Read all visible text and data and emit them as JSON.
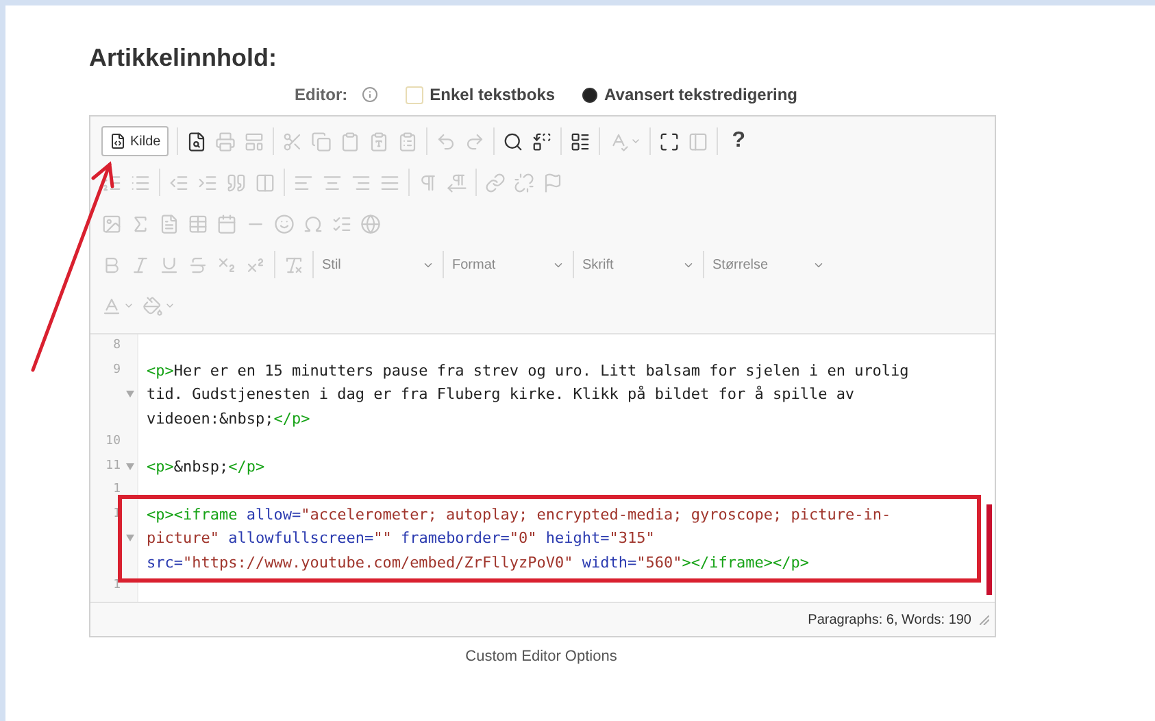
{
  "heading": "Artikkelinnhold:",
  "editor_options": {
    "label": "Editor:",
    "choices": [
      {
        "label": "Enkel tekstboks",
        "selected": false,
        "kind": "checkbox"
      },
      {
        "label": "Avansert tekstredigering",
        "selected": true,
        "kind": "radio"
      }
    ]
  },
  "toolbar": {
    "rows": [
      [
        [
          {
            "kind": "source",
            "label": "Kilde",
            "disabled": false
          }
        ],
        [
          {
            "kind": "icon",
            "disabled": false
          },
          {
            "kind": "icon",
            "disabled": true
          },
          {
            "kind": "icon",
            "disabled": true
          }
        ],
        [
          {
            "kind": "icon",
            "disabled": true
          },
          {
            "kind": "icon",
            "disabled": true
          },
          {
            "kind": "icon",
            "disabled": true
          },
          {
            "kind": "icon",
            "disabled": true
          },
          {
            "kind": "icon",
            "disabled": true
          }
        ],
        [
          {
            "kind": "icon",
            "disabled": true
          },
          {
            "kind": "icon",
            "disabled": true
          }
        ],
        [
          {
            "kind": "icon",
            "disabled": false
          },
          {
            "kind": "icon",
            "disabled": false
          }
        ],
        [
          {
            "kind": "icon",
            "disabled": false
          }
        ],
        [
          {
            "kind": "dropdown-icon",
            "disabled": true
          }
        ],
        [
          {
            "kind": "icon",
            "disabled": false
          },
          {
            "kind": "icon",
            "disabled": true
          }
        ],
        [
          {
            "kind": "text",
            "label": "?",
            "disabled": false
          }
        ]
      ],
      [
        [
          {
            "kind": "icon",
            "disabled": true
          },
          {
            "kind": "icon",
            "disabled": true
          }
        ],
        [
          {
            "kind": "icon",
            "disabled": true
          },
          {
            "kind": "icon",
            "disabled": true
          },
          {
            "kind": "icon",
            "disabled": true
          },
          {
            "kind": "icon",
            "disabled": true
          }
        ],
        [
          {
            "kind": "icon",
            "disabled": true
          },
          {
            "kind": "icon",
            "disabled": true
          },
          {
            "kind": "icon",
            "disabled": true
          },
          {
            "kind": "icon",
            "disabled": true
          }
        ],
        [
          {
            "kind": "icon",
            "disabled": true
          },
          {
            "kind": "icon",
            "disabled": true
          }
        ],
        [
          {
            "kind": "icon",
            "disabled": true
          },
          {
            "kind": "icon",
            "disabled": true
          },
          {
            "kind": "icon",
            "disabled": true
          }
        ]
      ],
      [
        [
          {
            "kind": "icon",
            "disabled": true
          },
          {
            "kind": "icon",
            "disabled": true
          },
          {
            "kind": "icon",
            "disabled": true
          },
          {
            "kind": "icon",
            "disabled": true
          },
          {
            "kind": "icon",
            "disabled": true
          },
          {
            "kind": "icon",
            "disabled": true
          },
          {
            "kind": "icon",
            "disabled": true
          },
          {
            "kind": "icon",
            "disabled": true
          },
          {
            "kind": "icon",
            "disabled": true
          },
          {
            "kind": "icon",
            "disabled": true
          }
        ]
      ],
      [
        [
          {
            "kind": "icon",
            "disabled": true
          },
          {
            "kind": "icon",
            "disabled": true
          },
          {
            "kind": "icon",
            "disabled": true
          },
          {
            "kind": "icon",
            "disabled": true
          },
          {
            "kind": "icon",
            "disabled": true
          },
          {
            "kind": "icon",
            "disabled": true
          }
        ],
        [
          {
            "kind": "icon",
            "disabled": true
          }
        ],
        [
          {
            "kind": "combo",
            "label": "Stil",
            "disabled": true
          }
        ],
        [
          {
            "kind": "combo",
            "label": "Format",
            "disabled": true
          }
        ],
        [
          {
            "kind": "combo",
            "label": "Skrift",
            "disabled": true
          }
        ],
        [
          {
            "kind": "combo",
            "label": "Størrelse",
            "disabled": true
          }
        ]
      ],
      [
        [
          {
            "kind": "dropdown-icon",
            "disabled": true
          },
          {
            "kind": "dropdown-icon",
            "disabled": true
          }
        ]
      ]
    ]
  },
  "code_lines": [
    {
      "number": "8",
      "foldable": false,
      "highlighted": false
    },
    {
      "number": "9",
      "foldable": true,
      "highlighted": false,
      "segments": [
        {
          "kind": "tag",
          "text": "<p>"
        },
        {
          "kind": "text",
          "text": "Her er en 15 minutters pause fra strev og uro. Litt balsam for sjelen i en urolig tid. Gudstjenesten i dag er fra Fluberg kirke. Klikk på bildet for å spille av videoen:&nbsp;"
        },
        {
          "kind": "tag",
          "text": "</p>"
        }
      ]
    },
    {
      "number": "10",
      "foldable": false,
      "highlighted": false
    },
    {
      "number": "11",
      "foldable": true,
      "highlighted": false,
      "segments": [
        {
          "kind": "tag",
          "text": "<p>"
        },
        {
          "kind": "text",
          "text": "&nbsp;"
        },
        {
          "kind": "tag",
          "text": "</p>"
        }
      ]
    },
    {
      "number": "1",
      "foldable": false,
      "highlighted": false
    },
    {
      "number": "1",
      "foldable": true,
      "highlighted": true,
      "segments": [
        {
          "kind": "tag",
          "text": "<p><iframe"
        },
        {
          "kind": "attr",
          "text": " allow="
        },
        {
          "kind": "value",
          "text": "\"accelerometer; autoplay; encrypted-media; gyroscope; picture-in-picture\""
        },
        {
          "kind": "attr",
          "text": " allowfullscreen="
        },
        {
          "kind": "value",
          "text": "\"\""
        },
        {
          "kind": "attr",
          "text": " frameborder="
        },
        {
          "kind": "value",
          "text": "\"0\""
        },
        {
          "kind": "attr",
          "text": " height="
        },
        {
          "kind": "value",
          "text": "\"315\""
        },
        {
          "kind": "attr",
          "text": " src="
        },
        {
          "kind": "value",
          "text": "\"https://www.youtube.com/embed/ZrFllyzPoV0\""
        },
        {
          "kind": "attr",
          "text": " width="
        },
        {
          "kind": "value",
          "text": "\"560\""
        },
        {
          "kind": "tag",
          "text": "></iframe></p>"
        }
      ]
    },
    {
      "number": "1",
      "foldable": false,
      "highlighted": false
    }
  ],
  "status_bar": "Paragraphs: 6, Words: 190",
  "footer": "Custom Editor Options",
  "annotations": {
    "arrow": true,
    "scroll_marker": true
  }
}
